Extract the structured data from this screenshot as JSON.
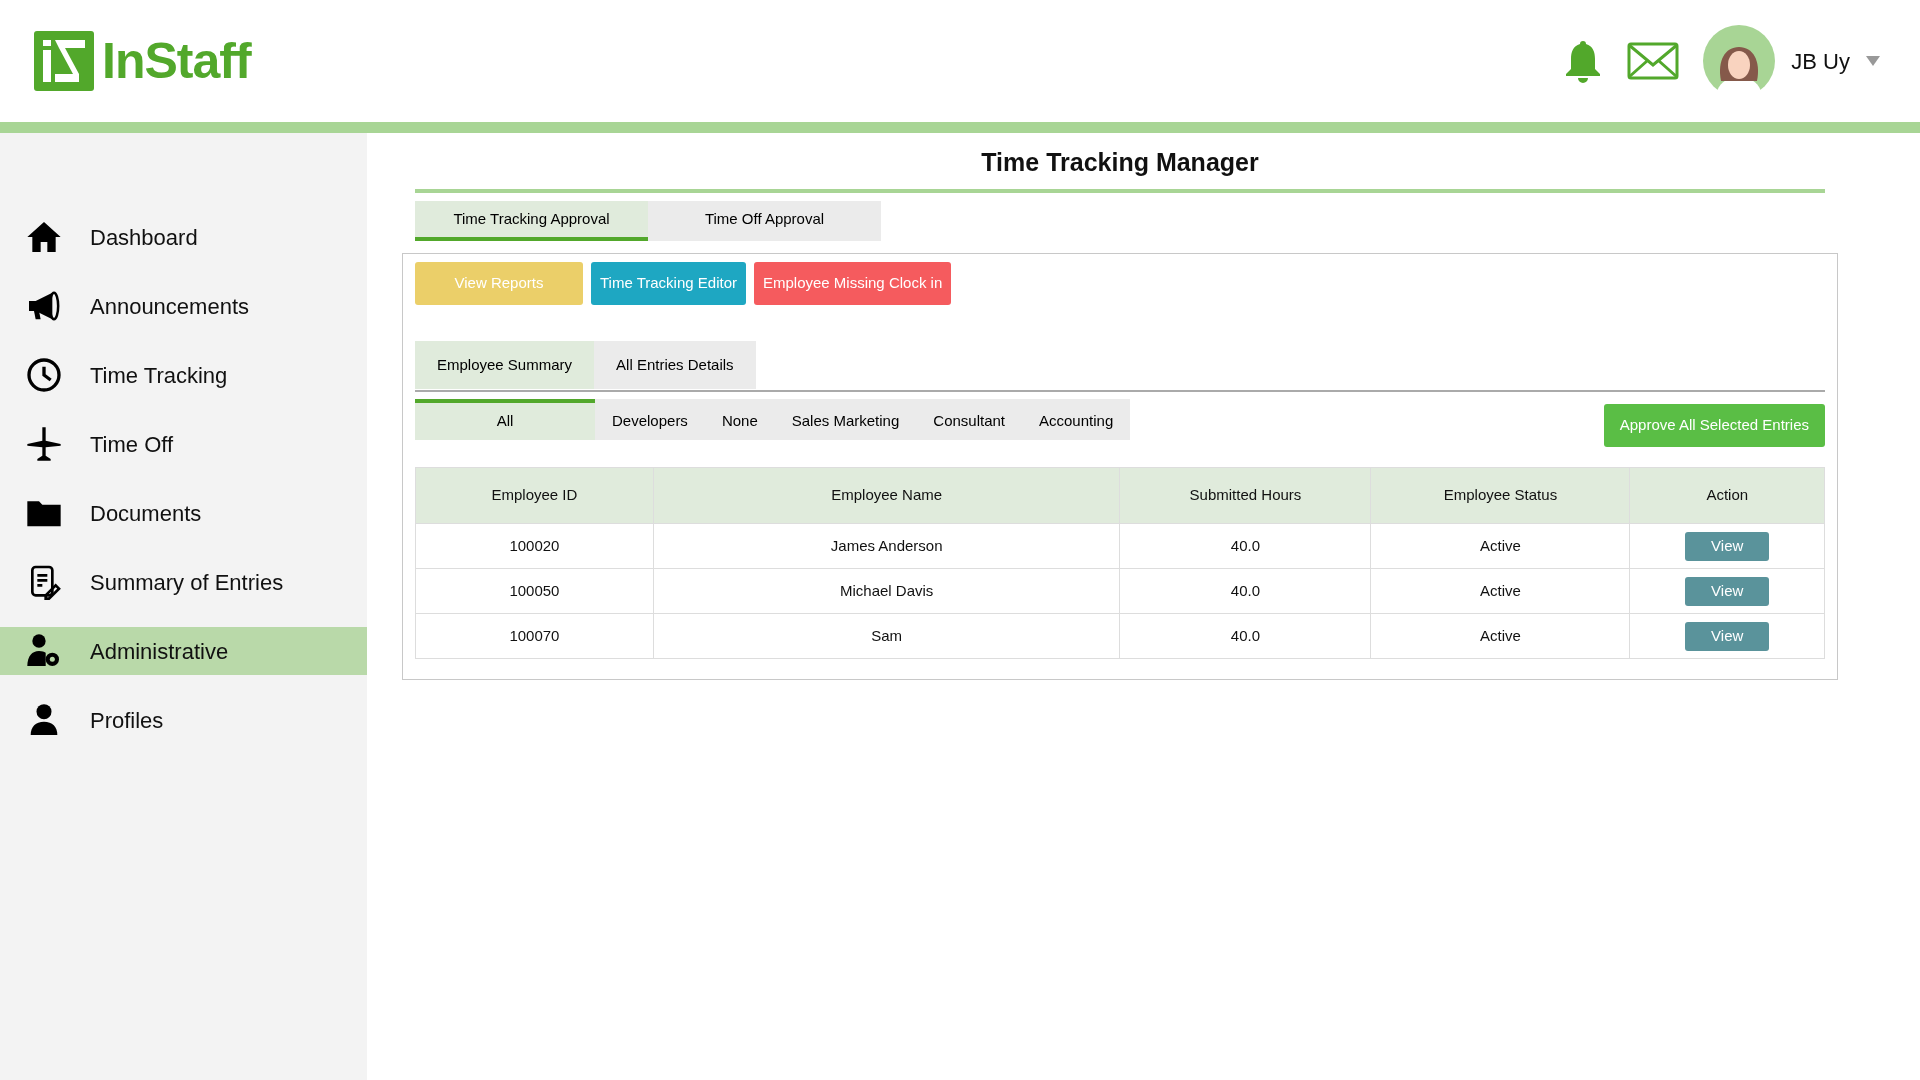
{
  "logo_text": "InStaff",
  "user": {
    "name": "JB Uy"
  },
  "sidebar": {
    "items": [
      {
        "label": "Dashboard",
        "selected": false
      },
      {
        "label": "Announcements",
        "selected": false
      },
      {
        "label": "Time Tracking",
        "selected": false
      },
      {
        "label": "Time Off",
        "selected": false
      },
      {
        "label": "Documents",
        "selected": false
      },
      {
        "label": "Summary of Entries",
        "selected": false
      },
      {
        "label": "Administrative",
        "selected": true
      },
      {
        "label": "Profiles",
        "selected": false
      }
    ]
  },
  "page_title": "Time Tracking Manager",
  "tabs": [
    {
      "label": "Time Tracking Approval",
      "selected": true
    },
    {
      "label": "Time Off Approval",
      "selected": false
    }
  ],
  "action_buttons": [
    {
      "label": "View Reports",
      "kind": "warning"
    },
    {
      "label": "Time Tracking Editor",
      "kind": "info"
    },
    {
      "label": "Employee Missing Clock in",
      "kind": "danger"
    }
  ],
  "view_tabs": [
    {
      "label": "Employee Summary",
      "selected": true
    },
    {
      "label": "All Entries Details",
      "selected": false
    }
  ],
  "filter_tabs": [
    {
      "label": "All",
      "selected": true
    },
    {
      "label": "Developers",
      "selected": false
    },
    {
      "label": "None",
      "selected": false
    },
    {
      "label": "Sales Marketing",
      "selected": false
    },
    {
      "label": "Consultant",
      "selected": false
    },
    {
      "label": "Accounting",
      "selected": false
    }
  ],
  "approve_button": "Approve All Selected Entries",
  "table": {
    "columns": [
      "Employee ID",
      "Employee Name",
      "Submitted Hours",
      "Employee Status",
      "Action"
    ],
    "rows": [
      {
        "cells": [
          "100020",
          "James Anderson",
          "40.0",
          "Active"
        ],
        "action": "View"
      },
      {
        "cells": [
          "100050",
          "Michael Davis",
          "40.0",
          "Active"
        ],
        "action": "View"
      },
      {
        "cells": [
          "100070",
          "Sam",
          "40.0",
          "Active"
        ],
        "action": "View"
      }
    ]
  }
}
